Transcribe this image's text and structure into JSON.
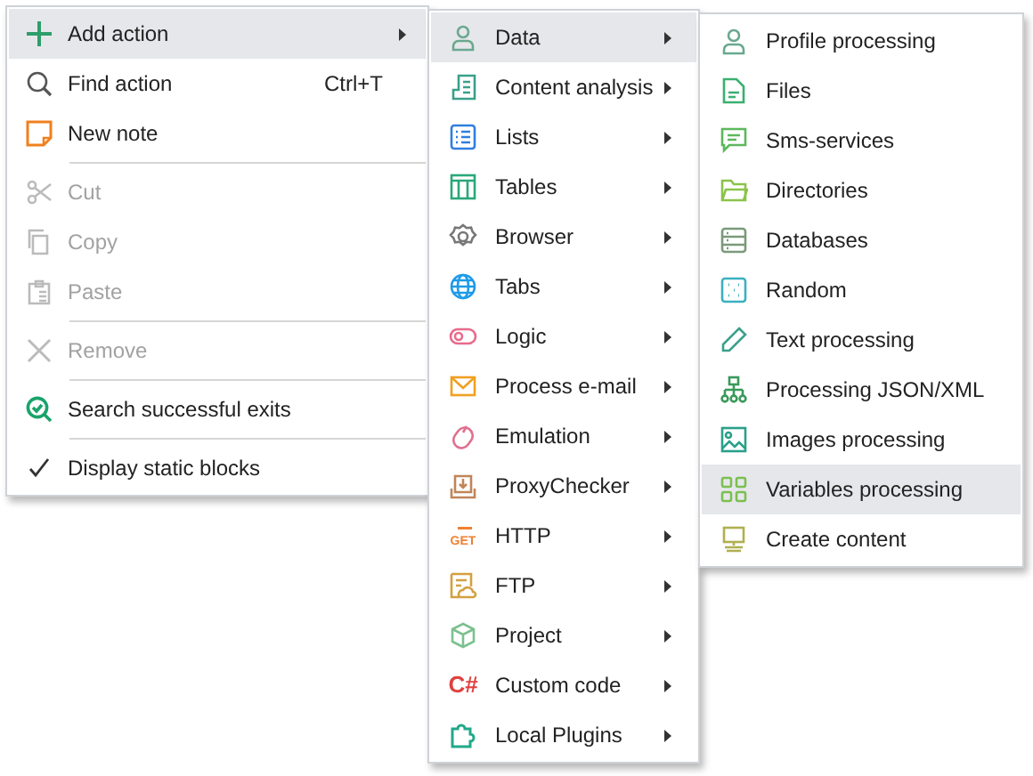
{
  "menus": [
    {
      "items": [
        {
          "kind": "item",
          "label": "Add action",
          "submenu": true,
          "selected": true,
          "disabled": false,
          "checked": false
        },
        {
          "kind": "item",
          "label": "Find action",
          "shortcut": "Ctrl+T",
          "submenu": false,
          "selected": false,
          "disabled": false,
          "checked": false
        },
        {
          "kind": "item",
          "label": "New note",
          "submenu": false,
          "selected": false,
          "disabled": false,
          "checked": false
        },
        {
          "kind": "separator"
        },
        {
          "kind": "item",
          "label": "Cut",
          "submenu": false,
          "selected": false,
          "disabled": true,
          "checked": false
        },
        {
          "kind": "item",
          "label": "Copy",
          "submenu": false,
          "selected": false,
          "disabled": true,
          "checked": false
        },
        {
          "kind": "item",
          "label": "Paste",
          "submenu": false,
          "selected": false,
          "disabled": true,
          "checked": false
        },
        {
          "kind": "separator"
        },
        {
          "kind": "item",
          "label": "Remove",
          "submenu": false,
          "selected": false,
          "disabled": true,
          "checked": false
        },
        {
          "kind": "separator"
        },
        {
          "kind": "item",
          "label": "Search successful exits",
          "submenu": false,
          "selected": false,
          "disabled": false,
          "checked": false
        },
        {
          "kind": "separator"
        },
        {
          "kind": "item",
          "label": "Display static blocks",
          "submenu": false,
          "selected": false,
          "disabled": false,
          "checked": true
        }
      ]
    },
    {
      "items": [
        {
          "kind": "item",
          "label": "Data",
          "submenu": true,
          "selected": true
        },
        {
          "kind": "item",
          "label": "Content analysis",
          "submenu": true,
          "selected": false
        },
        {
          "kind": "item",
          "label": "Lists",
          "submenu": true,
          "selected": false
        },
        {
          "kind": "item",
          "label": "Tables",
          "submenu": true,
          "selected": false
        },
        {
          "kind": "item",
          "label": "Browser",
          "submenu": true,
          "selected": false
        },
        {
          "kind": "item",
          "label": "Tabs",
          "submenu": true,
          "selected": false
        },
        {
          "kind": "item",
          "label": "Logic",
          "submenu": true,
          "selected": false
        },
        {
          "kind": "item",
          "label": "Process e-mail",
          "submenu": true,
          "selected": false
        },
        {
          "kind": "item",
          "label": "Emulation",
          "submenu": true,
          "selected": false
        },
        {
          "kind": "item",
          "label": "ProxyChecker",
          "submenu": true,
          "selected": false
        },
        {
          "kind": "item",
          "label": "HTTP",
          "icon_text": "GET",
          "submenu": true,
          "selected": false
        },
        {
          "kind": "item",
          "label": "FTP",
          "submenu": true,
          "selected": false
        },
        {
          "kind": "item",
          "label": "Project",
          "submenu": true,
          "selected": false
        },
        {
          "kind": "item",
          "label": "Custom code",
          "icon_text": "C#",
          "submenu": true,
          "selected": false
        },
        {
          "kind": "item",
          "label": "Local Plugins",
          "submenu": true,
          "selected": false
        }
      ]
    },
    {
      "items": [
        {
          "kind": "item",
          "label": "Profile processing",
          "submenu": false,
          "selected": false
        },
        {
          "kind": "item",
          "label": "Files",
          "submenu": false,
          "selected": false
        },
        {
          "kind": "item",
          "label": "Sms-services",
          "submenu": false,
          "selected": false
        },
        {
          "kind": "item",
          "label": "Directories",
          "submenu": false,
          "selected": false
        },
        {
          "kind": "item",
          "label": "Databases",
          "submenu": false,
          "selected": false
        },
        {
          "kind": "item",
          "label": "Random",
          "submenu": false,
          "selected": false
        },
        {
          "kind": "item",
          "label": "Text processing",
          "submenu": false,
          "selected": false
        },
        {
          "kind": "item",
          "label": "Processing JSON/XML",
          "submenu": false,
          "selected": false
        },
        {
          "kind": "item",
          "label": "Images processing",
          "submenu": false,
          "selected": false
        },
        {
          "kind": "item",
          "label": "Variables processing",
          "submenu": false,
          "selected": true
        },
        {
          "kind": "item",
          "label": "Create content",
          "submenu": false,
          "selected": false
        }
      ]
    }
  ]
}
